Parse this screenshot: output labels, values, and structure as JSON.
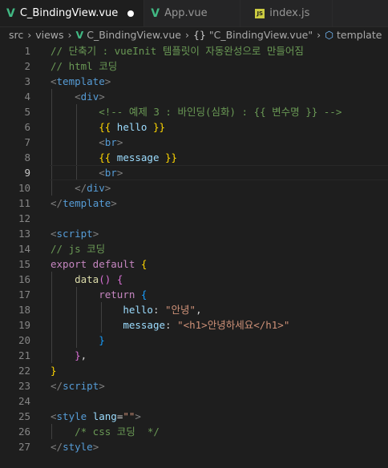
{
  "tabs": [
    {
      "label": "C_BindingView.vue"
    },
    {
      "label": "App.vue"
    },
    {
      "label": "index.js"
    }
  ],
  "breadcrumb": [
    "src",
    "views",
    "C_BindingView.vue",
    "\"C_BindingView.vue\"",
    "template"
  ],
  "editor": {
    "current_line": 9,
    "lines": [
      {
        "num": "1",
        "segs": [
          {
            "c": "c-com",
            "t": "// 단축기 : vueInit 템플릿이 자동완성으로 만들어짐"
          }
        ]
      },
      {
        "num": "2",
        "segs": [
          {
            "c": "c-com",
            "t": "// html 코딩"
          }
        ]
      },
      {
        "num": "3",
        "segs": [
          {
            "c": "c-brk",
            "t": "<"
          },
          {
            "c": "c-tag",
            "t": "template"
          },
          {
            "c": "c-brk",
            "t": ">"
          }
        ]
      },
      {
        "num": "4",
        "segs": [
          {
            "c": "c-txt",
            "t": "    "
          },
          {
            "c": "c-brk",
            "t": "<"
          },
          {
            "c": "c-tag",
            "t": "div"
          },
          {
            "c": "c-brk",
            "t": ">"
          }
        ]
      },
      {
        "num": "5",
        "segs": [
          {
            "c": "c-txt",
            "t": "        "
          },
          {
            "c": "c-com",
            "t": "<!-- 예제 3 : 바인딩(심화) : {{ 변수명 }} -->"
          }
        ]
      },
      {
        "num": "6",
        "segs": [
          {
            "c": "c-txt",
            "t": "        "
          },
          {
            "c": "c-br1",
            "t": "{{"
          },
          {
            "c": "c-prop",
            "t": " hello "
          },
          {
            "c": "c-br1",
            "t": "}}"
          }
        ]
      },
      {
        "num": "7",
        "segs": [
          {
            "c": "c-txt",
            "t": "        "
          },
          {
            "c": "c-brk",
            "t": "<"
          },
          {
            "c": "c-tag",
            "t": "br"
          },
          {
            "c": "c-brk",
            "t": ">"
          }
        ]
      },
      {
        "num": "8",
        "segs": [
          {
            "c": "c-txt",
            "t": "        "
          },
          {
            "c": "c-br1",
            "t": "{{"
          },
          {
            "c": "c-prop",
            "t": " message "
          },
          {
            "c": "c-br1",
            "t": "}}"
          }
        ]
      },
      {
        "num": "9",
        "segs": [
          {
            "c": "c-txt",
            "t": "        "
          },
          {
            "c": "c-brk",
            "t": "<"
          },
          {
            "c": "c-tag",
            "t": "br"
          },
          {
            "c": "c-brk",
            "t": ">"
          }
        ]
      },
      {
        "num": "10",
        "segs": [
          {
            "c": "c-txt",
            "t": "    "
          },
          {
            "c": "c-brk",
            "t": "</"
          },
          {
            "c": "c-tag",
            "t": "div"
          },
          {
            "c": "c-brk",
            "t": ">"
          }
        ]
      },
      {
        "num": "11",
        "segs": [
          {
            "c": "c-brk",
            "t": "</"
          },
          {
            "c": "c-tag",
            "t": "template"
          },
          {
            "c": "c-brk",
            "t": ">"
          }
        ]
      },
      {
        "num": "12",
        "segs": []
      },
      {
        "num": "13",
        "segs": [
          {
            "c": "c-brk",
            "t": "<"
          },
          {
            "c": "c-tag",
            "t": "script"
          },
          {
            "c": "c-brk",
            "t": ">"
          }
        ]
      },
      {
        "num": "14",
        "segs": [
          {
            "c": "c-com",
            "t": "// js 코딩"
          }
        ]
      },
      {
        "num": "15",
        "segs": [
          {
            "c": "c-kw",
            "t": "export default "
          },
          {
            "c": "c-br1",
            "t": "{"
          }
        ]
      },
      {
        "num": "16",
        "segs": [
          {
            "c": "c-txt",
            "t": "    "
          },
          {
            "c": "c-fn",
            "t": "data"
          },
          {
            "c": "c-br2",
            "t": "()"
          },
          {
            "c": "c-txt",
            "t": " "
          },
          {
            "c": "c-br2",
            "t": "{"
          }
        ]
      },
      {
        "num": "17",
        "segs": [
          {
            "c": "c-txt",
            "t": "        "
          },
          {
            "c": "c-kw",
            "t": "return"
          },
          {
            "c": "c-txt",
            "t": " "
          },
          {
            "c": "c-br3",
            "t": "{"
          }
        ]
      },
      {
        "num": "18",
        "segs": [
          {
            "c": "c-txt",
            "t": "            "
          },
          {
            "c": "c-prop",
            "t": "hello"
          },
          {
            "c": "c-txt",
            "t": ": "
          },
          {
            "c": "c-str",
            "t": "\"안녕\""
          },
          {
            "c": "c-txt",
            "t": ","
          }
        ]
      },
      {
        "num": "19",
        "segs": [
          {
            "c": "c-txt",
            "t": "            "
          },
          {
            "c": "c-prop",
            "t": "message"
          },
          {
            "c": "c-txt",
            "t": ": "
          },
          {
            "c": "c-str",
            "t": "\"<h1>안녕하세요</h1>\""
          }
        ]
      },
      {
        "num": "20",
        "segs": [
          {
            "c": "c-txt",
            "t": "        "
          },
          {
            "c": "c-br3",
            "t": "}"
          }
        ]
      },
      {
        "num": "21",
        "segs": [
          {
            "c": "c-txt",
            "t": "    "
          },
          {
            "c": "c-br2",
            "t": "}"
          },
          {
            "c": "c-txt",
            "t": ","
          }
        ]
      },
      {
        "num": "22",
        "segs": [
          {
            "c": "c-br1",
            "t": "}"
          }
        ]
      },
      {
        "num": "23",
        "segs": [
          {
            "c": "c-brk",
            "t": "</"
          },
          {
            "c": "c-tag",
            "t": "script"
          },
          {
            "c": "c-brk",
            "t": ">"
          }
        ]
      },
      {
        "num": "24",
        "segs": []
      },
      {
        "num": "25",
        "segs": [
          {
            "c": "c-brk",
            "t": "<"
          },
          {
            "c": "c-tag",
            "t": "style"
          },
          {
            "c": "c-txt",
            "t": " "
          },
          {
            "c": "c-prop",
            "t": "lang"
          },
          {
            "c": "c-txt",
            "t": "="
          },
          {
            "c": "c-str",
            "t": "\"\""
          },
          {
            "c": "c-brk",
            "t": ">"
          }
        ]
      },
      {
        "num": "26",
        "segs": [
          {
            "c": "c-txt",
            "t": "    "
          },
          {
            "c": "c-com",
            "t": "/* css 코딩  */"
          }
        ]
      },
      {
        "num": "27",
        "segs": [
          {
            "c": "c-brk",
            "t": "</"
          },
          {
            "c": "c-tag",
            "t": "style"
          },
          {
            "c": "c-brk",
            "t": ">"
          }
        ]
      }
    ]
  }
}
